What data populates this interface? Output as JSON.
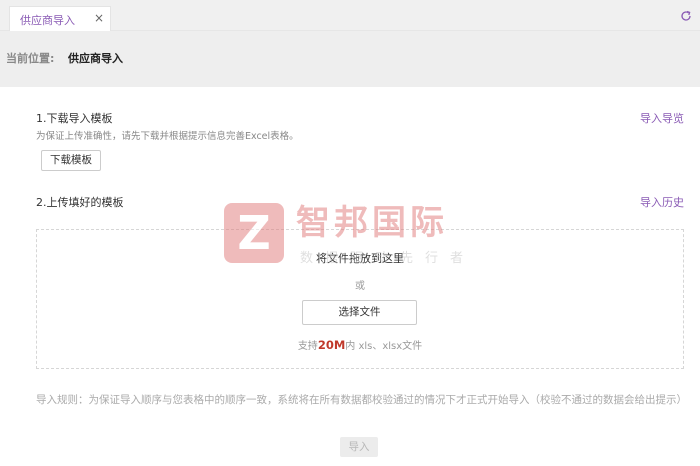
{
  "tab": {
    "label": "供应商导入",
    "close": "×"
  },
  "breadcrumb": {
    "label": "当前位置:",
    "value": "供应商导入"
  },
  "section1": {
    "title": "1.下载导入模板",
    "link": "导入导览",
    "description": "为保证上传准确性，请先下载并根据提示信息完善Excel表格。",
    "download_button": "下载模板"
  },
  "section2": {
    "title": "2.上传填好的模板",
    "link": "导入历史"
  },
  "dropzone": {
    "drag_text": "将文件拖放到这里",
    "or_text": "或",
    "choose_button": "选择文件",
    "support_prefix": "支持",
    "support_size": "20M",
    "support_suffix": "内 xls、xlsx文件"
  },
  "rules": "导入规则：为保证导入顺序与您表格中的顺序一致，系统将在所有数据都校验通过的情况下才正式开始导入（校验不通过的数据会给出提示）",
  "import_button": "导入",
  "watermark": {
    "logo": "Z",
    "name": "智邦国际",
    "slogan": "数据驱动先行者"
  },
  "colors": {
    "accent": "#8a5bb5",
    "highlight": "#c0392b",
    "watermark": "#e07a7a"
  }
}
